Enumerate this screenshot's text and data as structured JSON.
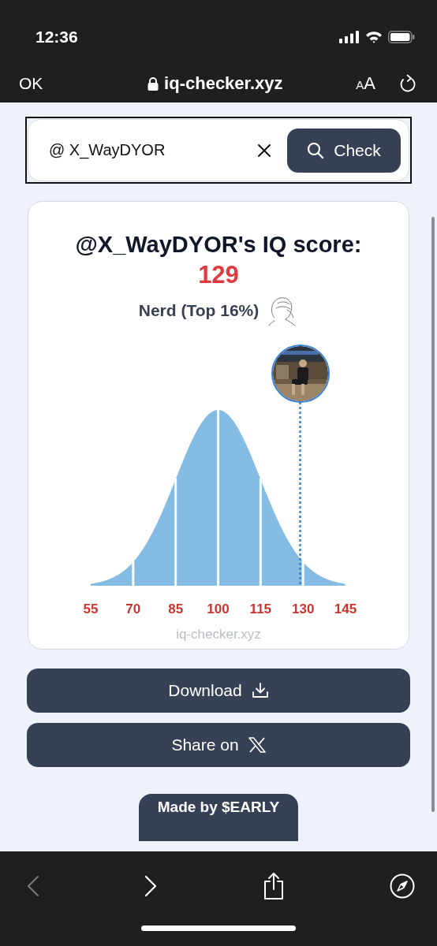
{
  "status_bar": {
    "time": "12:36"
  },
  "browser_bar": {
    "done": "OK",
    "address": "iq-checker.xyz",
    "text_size": "AA"
  },
  "search": {
    "value": "@ X_WayDYOR",
    "button": "Check"
  },
  "result": {
    "title": "@X_WayDYOR's IQ score:",
    "score": "129",
    "rank": "Nerd (Top 16%)",
    "chart": {
      "x_labels": [
        "55",
        "70",
        "85",
        "100",
        "115",
        "130",
        "145"
      ]
    },
    "footer": "iq-checker.xyz"
  },
  "buttons": {
    "download": "Download",
    "share": "Share on"
  },
  "made_by": "Made by $EARLY",
  "toolbar": {
    "back_disabled": true
  }
}
